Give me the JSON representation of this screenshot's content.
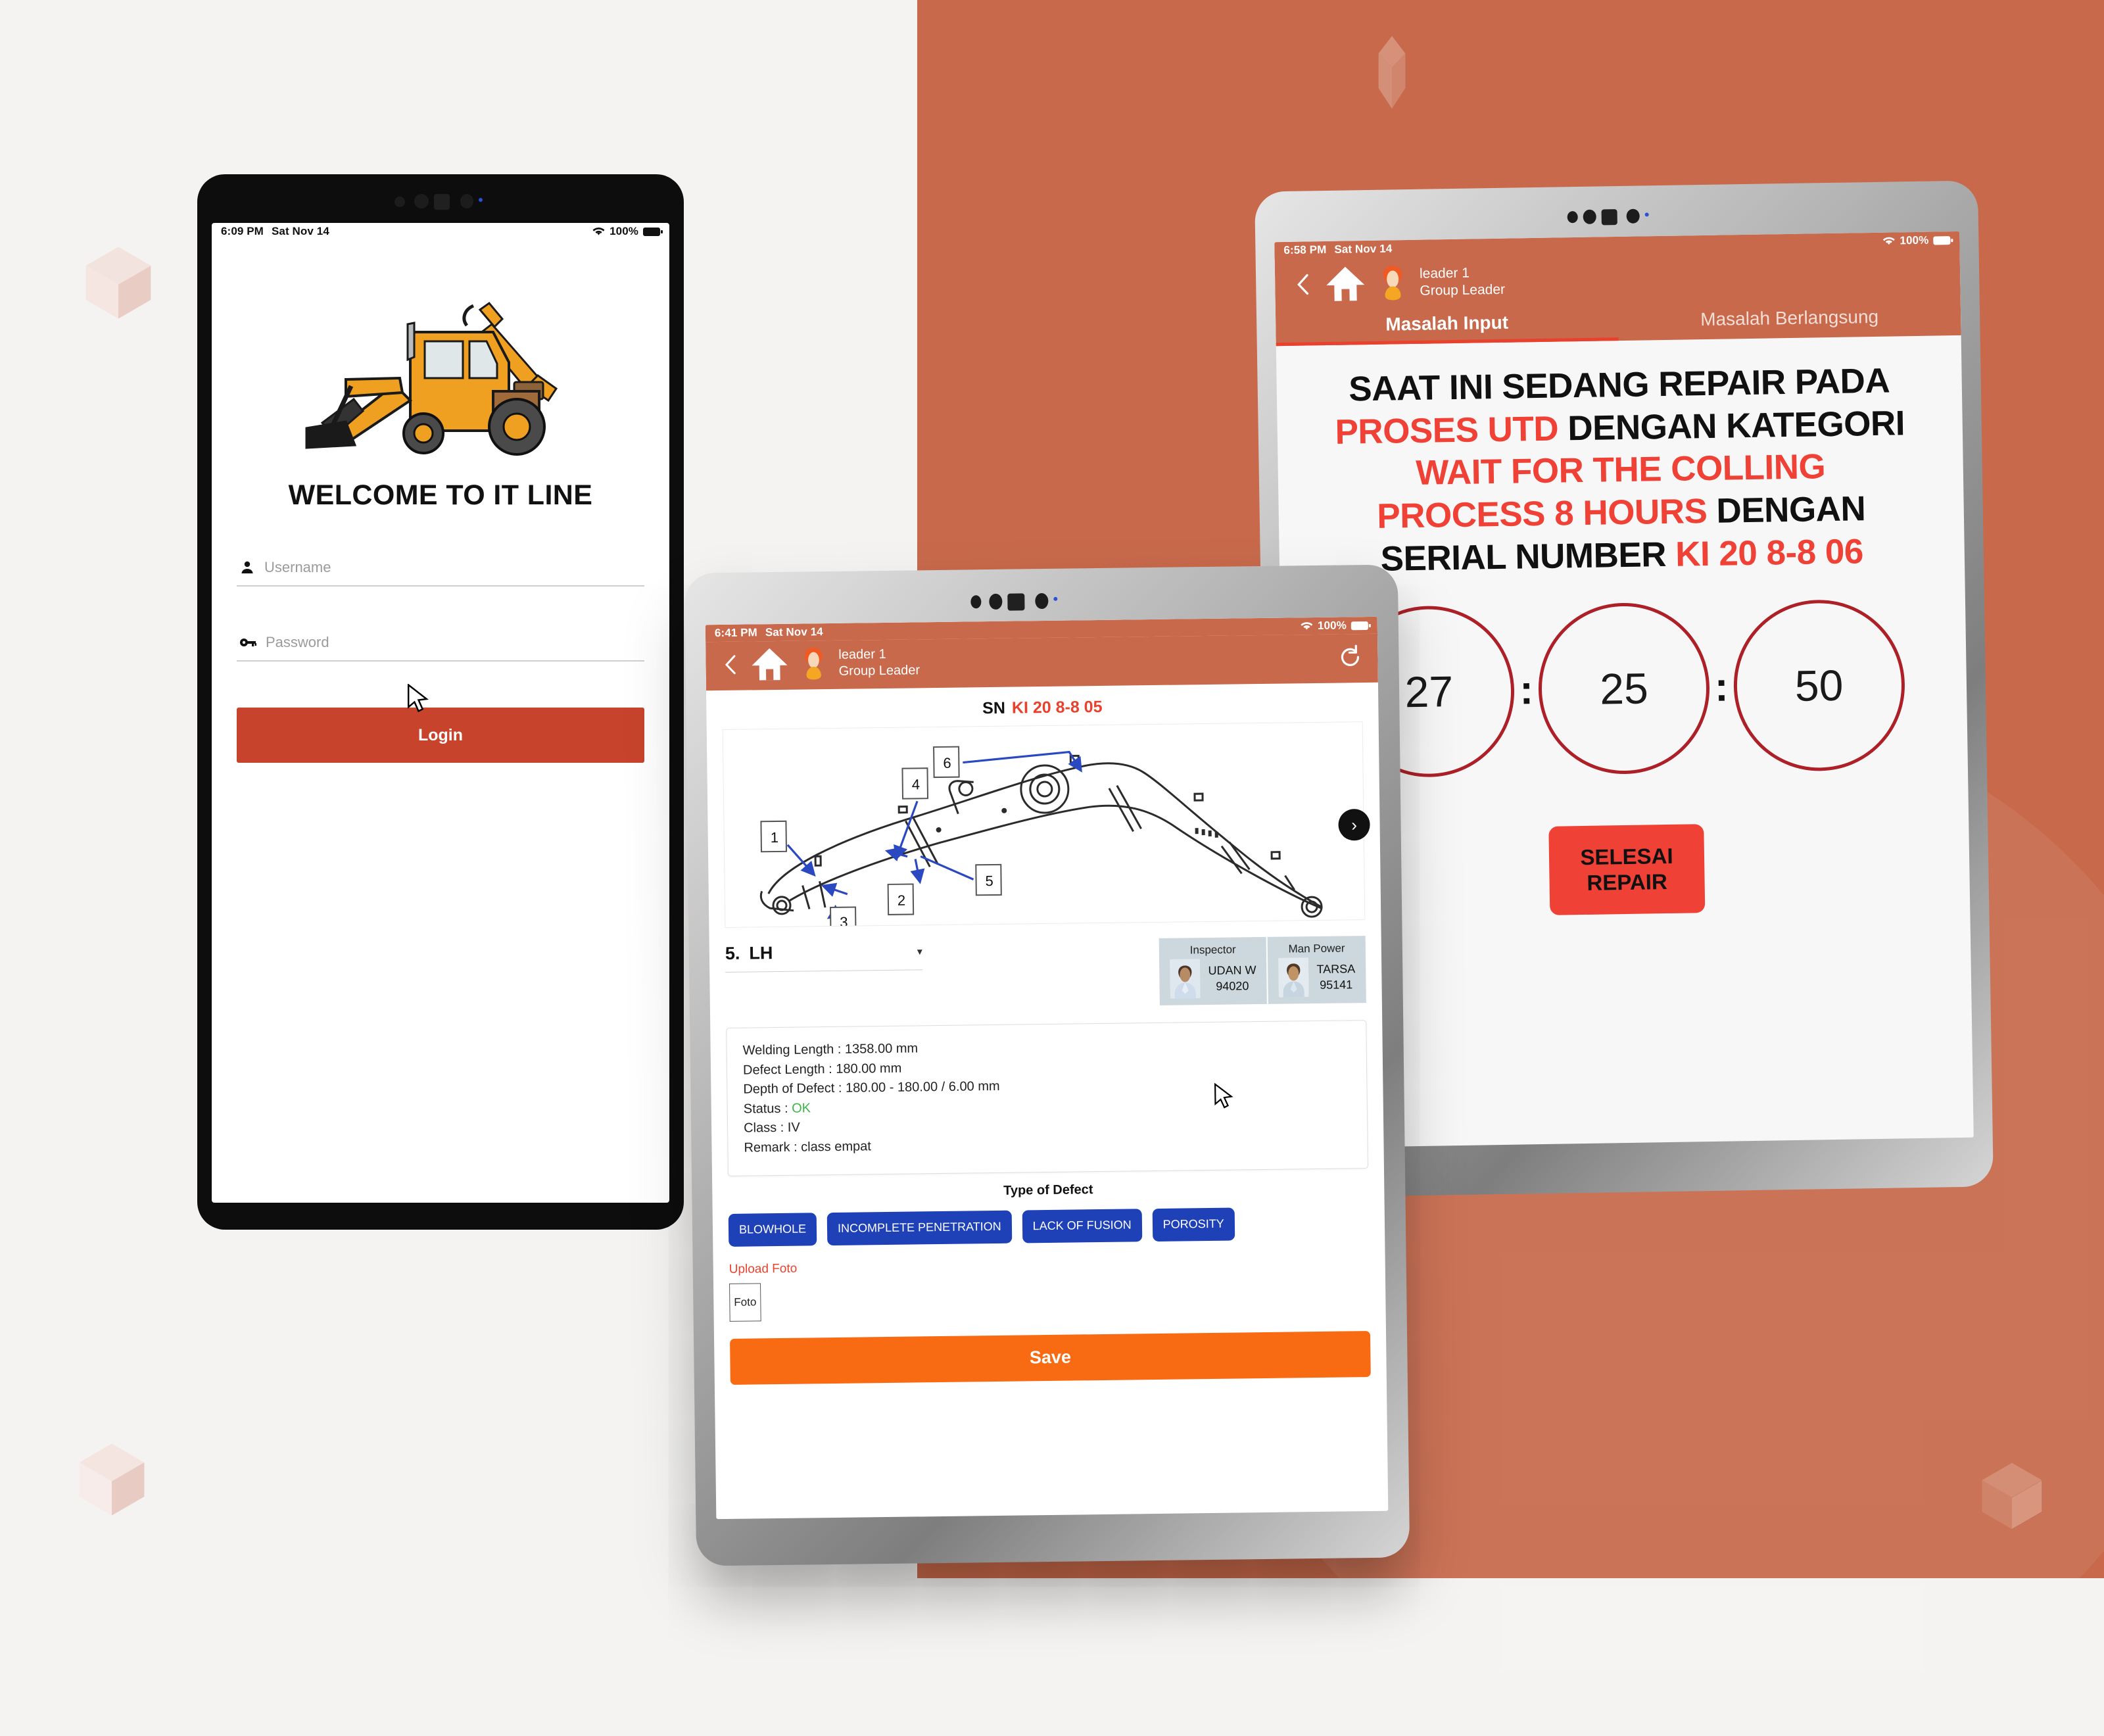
{
  "background": {
    "left_color": "#f4f3f1",
    "right_color": "#c8694b",
    "cube_light": "#f0dcd6",
    "cube_dark": "#dfb6a9"
  },
  "login_tablet": {
    "status": {
      "time": "6:09 PM",
      "date": "Sat Nov 14",
      "battery": "100%"
    },
    "logo_alt": "excavator-backhoe-loader",
    "welcome": "WELCOME TO IT LINE",
    "username": {
      "placeholder": "Username",
      "value": "",
      "icon": "person-icon"
    },
    "password": {
      "placeholder": "Password",
      "value": "",
      "icon": "key-icon"
    },
    "login_label": "Login",
    "login_color": "#c8432c"
  },
  "repair_tablet": {
    "status": {
      "time": "6:58 PM",
      "date": "Sat Nov 14",
      "battery": "100%"
    },
    "user": {
      "name": "leader 1",
      "role": "Group Leader"
    },
    "tabs": [
      {
        "label": "Masalah Input",
        "active": true
      },
      {
        "label": "Masalah Berlangsung",
        "active": false
      }
    ],
    "message": {
      "line1_black": "SAAT INI SEDANG REPAIR PADA",
      "line2_red": "PROSES UTD",
      "line2_black": " DENGAN KATEGORI",
      "line3_red": "WAIT FOR THE COLLING",
      "line4_red": "PROCESS 8 HOURS",
      "line4_black": " DENGAN",
      "line5_black": "SERIAL NUMBER",
      "line5_red": "KI 20 8-8 06"
    },
    "timer": {
      "hours": "27",
      "minutes": "25",
      "seconds": "50",
      "separator": ":",
      "ring_color": "#ad2028"
    },
    "finish_button": {
      "line1": "SELESAI",
      "line2": "REPAIR",
      "color": "#ef4136"
    }
  },
  "form_tablet": {
    "status": {
      "time": "6:41 PM",
      "date": "Sat Nov 14",
      "battery": "100%"
    },
    "user": {
      "name": "leader 1",
      "role": "Group Leader"
    },
    "refresh_icon": "refresh-icon",
    "back_icon": "chevron-left-icon",
    "home_icon": "home-icon",
    "serial": {
      "label": "SN",
      "value": "KI 20 8-8 05"
    },
    "diagram": {
      "alt": "excavator-boom-technical-drawing",
      "callouts": [
        "1",
        "2",
        "3",
        "4",
        "5",
        "6"
      ],
      "next_icon": "chevron-right-icon"
    },
    "position_dropdown": {
      "number": "5.",
      "value": "LH",
      "caret": "▾"
    },
    "people": [
      {
        "role": "Inspector",
        "name": "UDAN W",
        "id": "94020"
      },
      {
        "role": "Man Power",
        "name": "TARSA",
        "id": "95141"
      }
    ],
    "details": {
      "welding_length": "Welding Length : 1358.00 mm",
      "defect_length": "Defect Length : 180.00 mm",
      "depth_of_defect": "Depth of Defect : 180.00 - 180.00 / 6.00 mm",
      "status_label": "Status : ",
      "status_value": "OK",
      "class": "Class : IV",
      "remark": "Remark : class empat"
    },
    "type_of_defect": {
      "title": "Type of Defect",
      "options": [
        "BLOWHOLE",
        "INCOMPLETE PENETRATION",
        "LACK OF FUSION",
        "POROSITY"
      ],
      "color": "#1f41b8"
    },
    "upload": {
      "label": "Upload Foto",
      "box_label": "Foto"
    },
    "save": {
      "label": "Save",
      "color": "#f96b13"
    }
  }
}
